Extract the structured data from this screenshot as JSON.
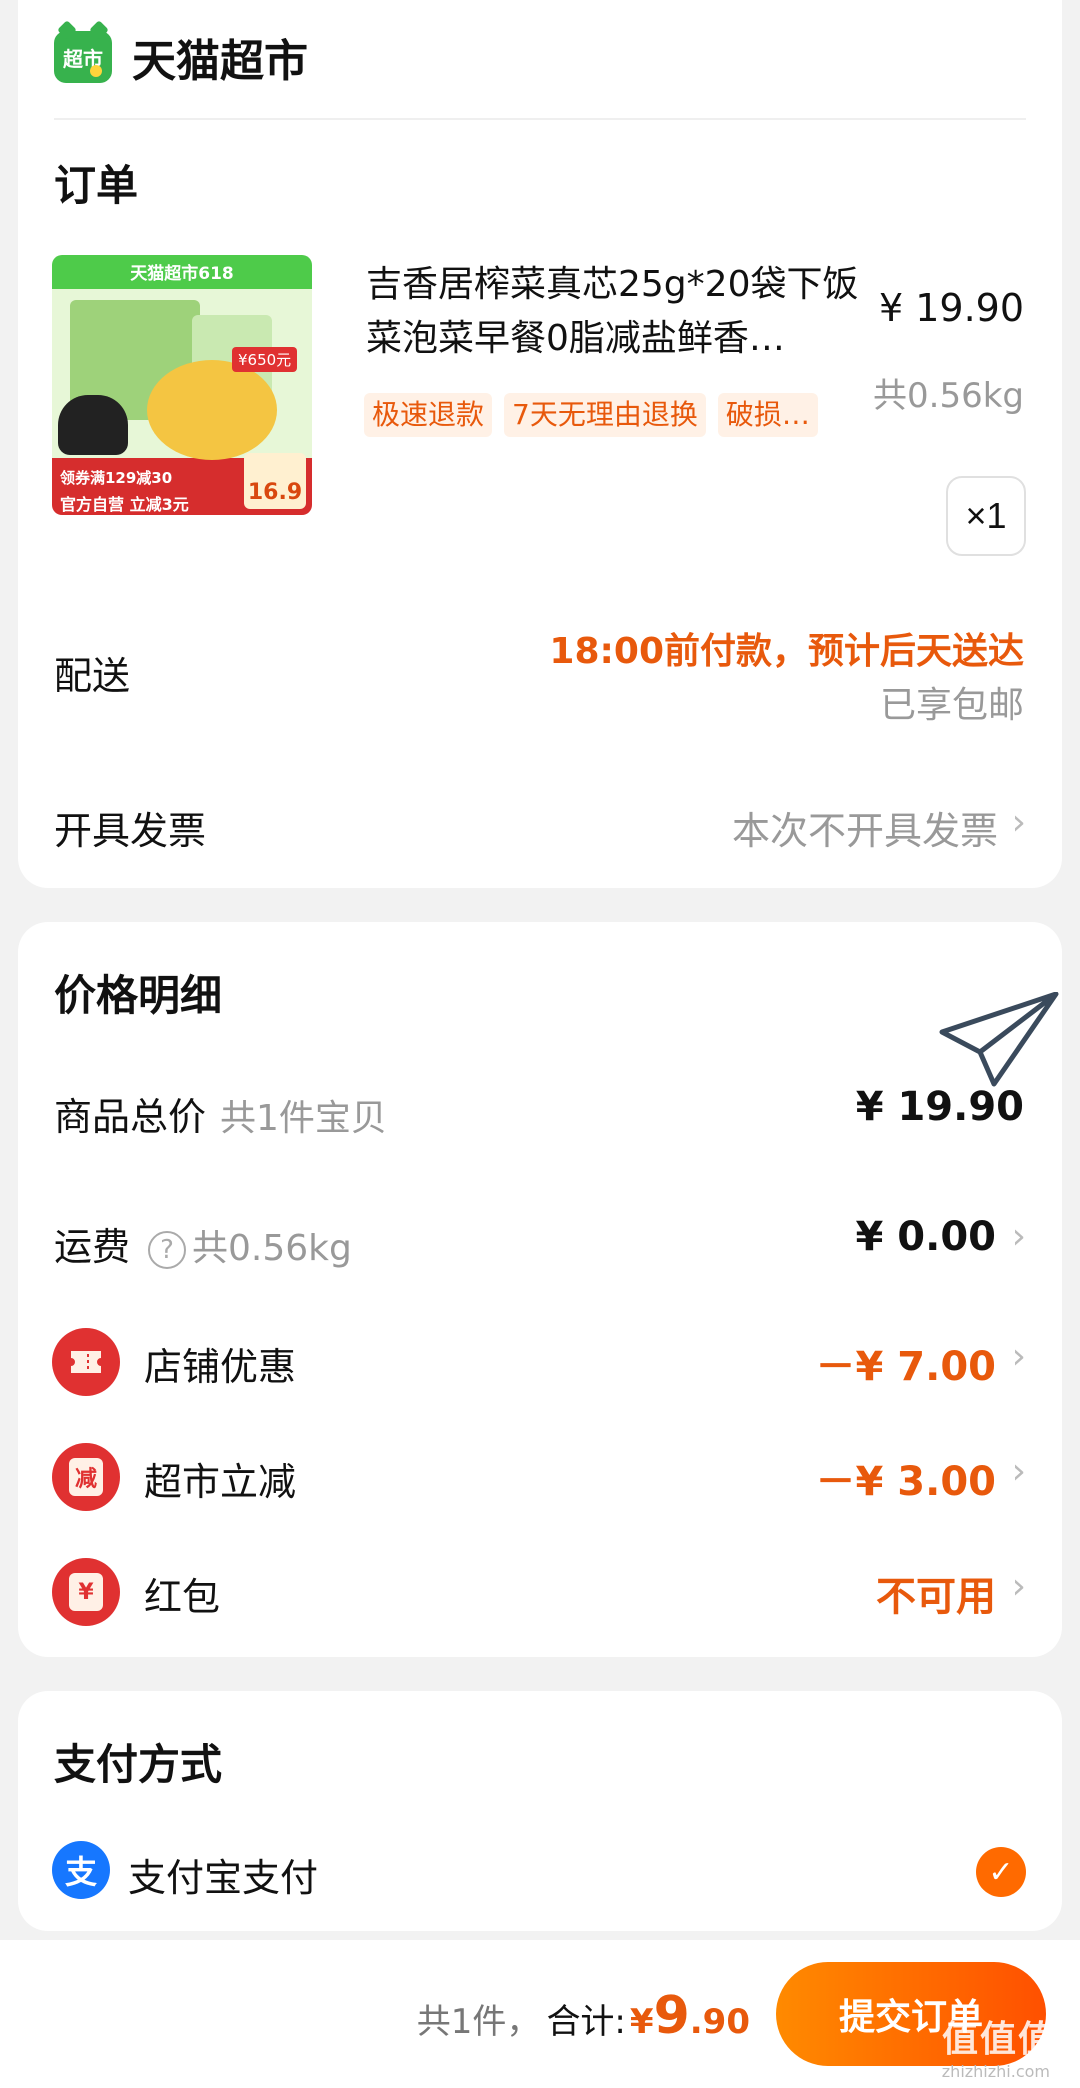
{
  "shop": {
    "name": "天猫超市",
    "logo_text": "超市"
  },
  "order": {
    "title": "订单",
    "product": {
      "image": {
        "banner": "天猫超市618",
        "badge": "¥650元",
        "promo_line1": "领券满129减30",
        "promo_line2": "官方自营 立减3元",
        "price_tag": "16.9"
      },
      "title": "吉香居榨菜真芯25g*20袋下饭菜泡菜早餐0脂减盐鲜香…",
      "tags": [
        "极速退款",
        "7天无理由退换",
        "破损…"
      ],
      "price": "¥ 19.90",
      "weight": "共0.56kg",
      "quantity": "×1"
    },
    "delivery": {
      "label": "配送",
      "time": "18:00前付款，预计后天送达",
      "shipping": "已享包邮"
    },
    "invoice": {
      "label": "开具发票",
      "value": "本次不开具发票"
    }
  },
  "price_detail": {
    "title": "价格明细",
    "rows": [
      {
        "label": "商品总价",
        "sub": "共1件宝贝",
        "value": "¥ 19.90"
      },
      {
        "label": "运费",
        "sub": "共0.56kg",
        "value": "¥ 0.00"
      },
      {
        "label": "店铺优惠",
        "value": "－¥ 7.00",
        "icon": "ticket-icon"
      },
      {
        "label": "超市立减",
        "value": "－¥ 3.00",
        "icon": "discount-icon",
        "icon_text": "减"
      },
      {
        "label": "红包",
        "value": "不可用",
        "icon": "red-packet-icon",
        "icon_text": "¥"
      }
    ]
  },
  "payment": {
    "title": "支付方式",
    "method": {
      "label": "支付宝支付",
      "icon_text": "支",
      "selected": true
    }
  },
  "bottom_bar": {
    "count": "共1件，",
    "total_label": "合计:",
    "currency": "¥",
    "total_int": "9",
    "total_dec": ".90",
    "submit_label": "提交订单",
    "watermark": "值值值",
    "watermark_sub": "zhizhizhi.com"
  },
  "colors": {
    "accent": "#ff5000",
    "discount": "#e8590c",
    "alipay": "#1677ff",
    "tmall_green": "#37b24d"
  }
}
